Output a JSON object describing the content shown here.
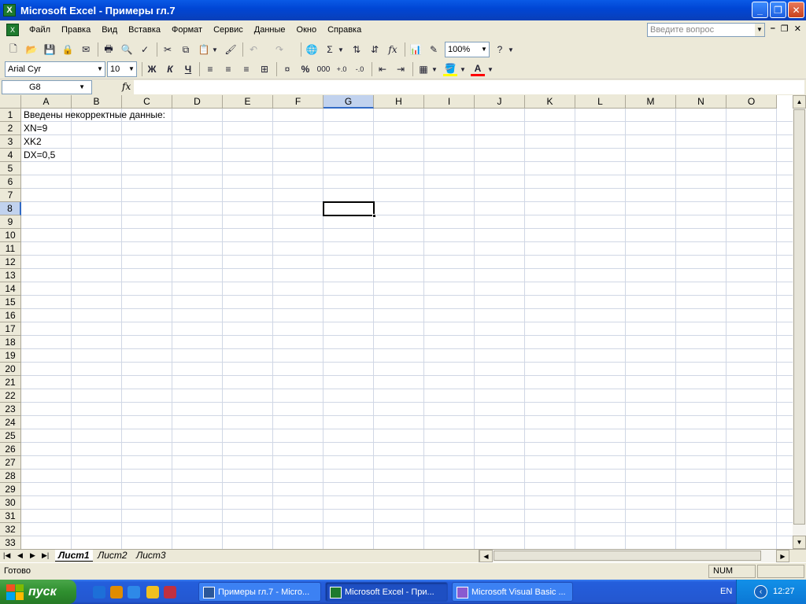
{
  "window": {
    "title": "Microsoft Excel - Примеры гл.7",
    "minimize": "_",
    "maximize": "❐",
    "close": "✕"
  },
  "menu": {
    "items": [
      "Файл",
      "Правка",
      "Вид",
      "Вставка",
      "Формат",
      "Сервис",
      "Данные",
      "Окно",
      "Справка"
    ],
    "help_placeholder": "Введите вопрос"
  },
  "toolbar": {
    "zoom": "100%",
    "font_name": "Arial Cyr",
    "font_size": "10",
    "bold": "Ж",
    "italic": "К",
    "underline": "Ч",
    "percent": "%",
    "thousands": "000",
    "sum": "Σ",
    "fx": "fx"
  },
  "formula_bar": {
    "name_box": "G8",
    "fx_label": "fx",
    "content": ""
  },
  "grid": {
    "columns": [
      "A",
      "B",
      "C",
      "D",
      "E",
      "F",
      "G",
      "H",
      "I",
      "J",
      "K",
      "L",
      "M",
      "N",
      "O"
    ],
    "active_column": "G",
    "rows": [
      "1",
      "2",
      "3",
      "4",
      "5",
      "6",
      "7",
      "8",
      "9",
      "10",
      "11",
      "12",
      "13",
      "14",
      "15",
      "16",
      "17",
      "18",
      "19",
      "20",
      "21",
      "22",
      "23",
      "24",
      "25",
      "26",
      "27",
      "28",
      "29",
      "30",
      "31",
      "32",
      "33"
    ],
    "active_row": "8",
    "cells": {
      "A1": "Введены некорректные данные:",
      "A2": "XN=9",
      "A3": "XK2",
      "A4": "DX=0,5"
    }
  },
  "sheets": {
    "tabs": [
      "Лист1",
      "Лист2",
      "Лист3"
    ],
    "active": "Лист1"
  },
  "status": {
    "ready": "Готово",
    "num": "NUM"
  },
  "taskbar": {
    "start": "пуск",
    "tasks": [
      "Примеры гл.7 - Micro...",
      "Microsoft Excel - При...",
      "Microsoft Visual Basic ..."
    ],
    "active_task": "Microsoft Excel - При...",
    "language": "EN",
    "clock": "12:27"
  }
}
